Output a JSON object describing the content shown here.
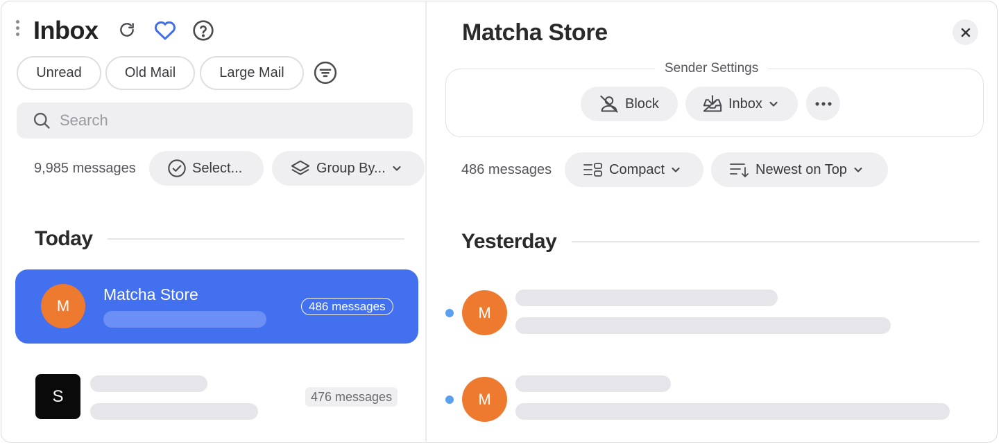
{
  "left": {
    "title": "Inbox",
    "filters": [
      "Unread",
      "Old Mail",
      "Large Mail"
    ],
    "search": {
      "placeholder": "Search",
      "value": ""
    },
    "message_count": "9,985 messages",
    "select_label": "Select...",
    "group_by_label": "Group By...",
    "section": "Today",
    "senders": [
      {
        "initial": "M",
        "name": "Matcha Store",
        "count": "486 messages",
        "selected": true
      },
      {
        "initial": "S",
        "name": "",
        "count": "476 messages",
        "selected": false
      }
    ]
  },
  "right": {
    "title": "Matcha Store",
    "sender_settings_label": "Sender Settings",
    "block_label": "Block",
    "inbox_label": "Inbox",
    "message_count": "486 messages",
    "view_label": "Compact",
    "sort_label": "Newest on Top",
    "section": "Yesterday",
    "messages": [
      {
        "initial": "M",
        "unread": true
      },
      {
        "initial": "M",
        "unread": true
      }
    ]
  },
  "colors": {
    "accent": "#4270ef",
    "avatar_orange": "#ee7a2f",
    "unread_dot": "#5aa0ee",
    "heart": "#3f6ee8"
  },
  "icons": [
    "drag-handle-icon",
    "refresh-icon",
    "heart-icon",
    "help-icon",
    "filter-icon",
    "search-icon",
    "check-circle-icon",
    "layers-icon",
    "chevron-down-icon",
    "close-icon",
    "block-sender-icon",
    "inbox-tray-icon",
    "more-icon",
    "compact-view-icon",
    "sort-icon"
  ]
}
